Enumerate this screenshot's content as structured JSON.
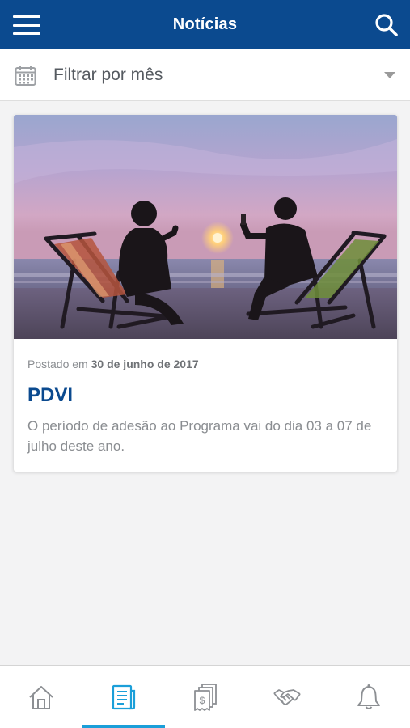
{
  "header": {
    "title": "Notícias",
    "menu_icon": "hamburger-menu-icon",
    "search_icon": "search-icon",
    "background": "#0b4a8f"
  },
  "filter": {
    "icon": "calendar-icon",
    "label": "Filtrar por mês",
    "dropdown_icon": "caret-down-icon"
  },
  "news": [
    {
      "image": "beach-sunset-deck-chairs-photo",
      "posted_prefix": "Postado em",
      "posted_date": "30 de junho de 2017",
      "title": "PDVI",
      "summary": "O período de adesão ao Programa vai do dia 03 a 07 de julho deste ano."
    }
  ],
  "tabbar": {
    "active_index": 1,
    "accent": "#1b9fd9",
    "items": [
      {
        "icon": "home-icon"
      },
      {
        "icon": "news-icon"
      },
      {
        "icon": "receipts-icon"
      },
      {
        "icon": "handshake-icon"
      },
      {
        "icon": "bell-icon"
      }
    ]
  }
}
